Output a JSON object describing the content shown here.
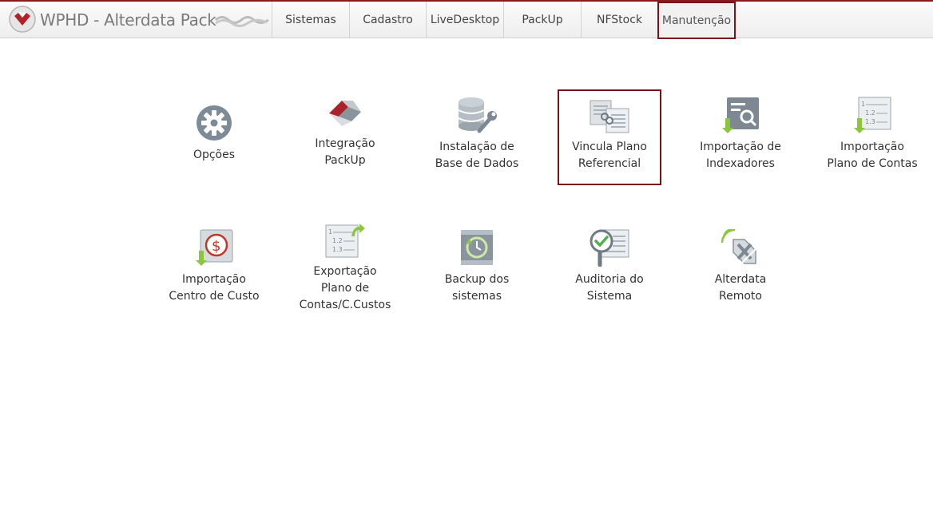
{
  "app": {
    "title": "WPHD - Alterdata Pack"
  },
  "nav": {
    "tabs": [
      {
        "label": "Sistemas"
      },
      {
        "label": "Cadastro"
      },
      {
        "label": "LiveDesktop"
      },
      {
        "label": "PackUp"
      },
      {
        "label": "NFStock"
      },
      {
        "label": "Manutenção",
        "active": true
      }
    ]
  },
  "tiles": [
    {
      "label": "Opções",
      "icon": "gear-icon"
    },
    {
      "label": "Integração\nPackUp",
      "icon": "packup-logo-icon"
    },
    {
      "label": "Instalação de\nBase de Dados",
      "icon": "database-wrench-icon"
    },
    {
      "label": "Vincula Plano\nReferencial",
      "icon": "linked-documents-icon",
      "selected": true
    },
    {
      "label": "Importação de\nIndexadores",
      "icon": "import-search-icon"
    },
    {
      "label": "Importação\nPlano de Contas",
      "icon": "import-list-icon"
    },
    {
      "label": "Importação\nCentro de Custo",
      "icon": "import-money-icon"
    },
    {
      "label": "Exportação\nPlano de\nContas/C.Custos",
      "icon": "export-list-icon"
    },
    {
      "label": "Backup dos\nsistemas",
      "icon": "backup-clock-icon"
    },
    {
      "label": "Auditoria do\nSistema",
      "icon": "audit-check-icon"
    },
    {
      "label": "Alterdata\nRemoto",
      "icon": "remote-signal-icon"
    }
  ],
  "colors": {
    "accent": "#7a1216",
    "brand": "#8b1a1f",
    "arrow_green": "#8cc63f"
  }
}
